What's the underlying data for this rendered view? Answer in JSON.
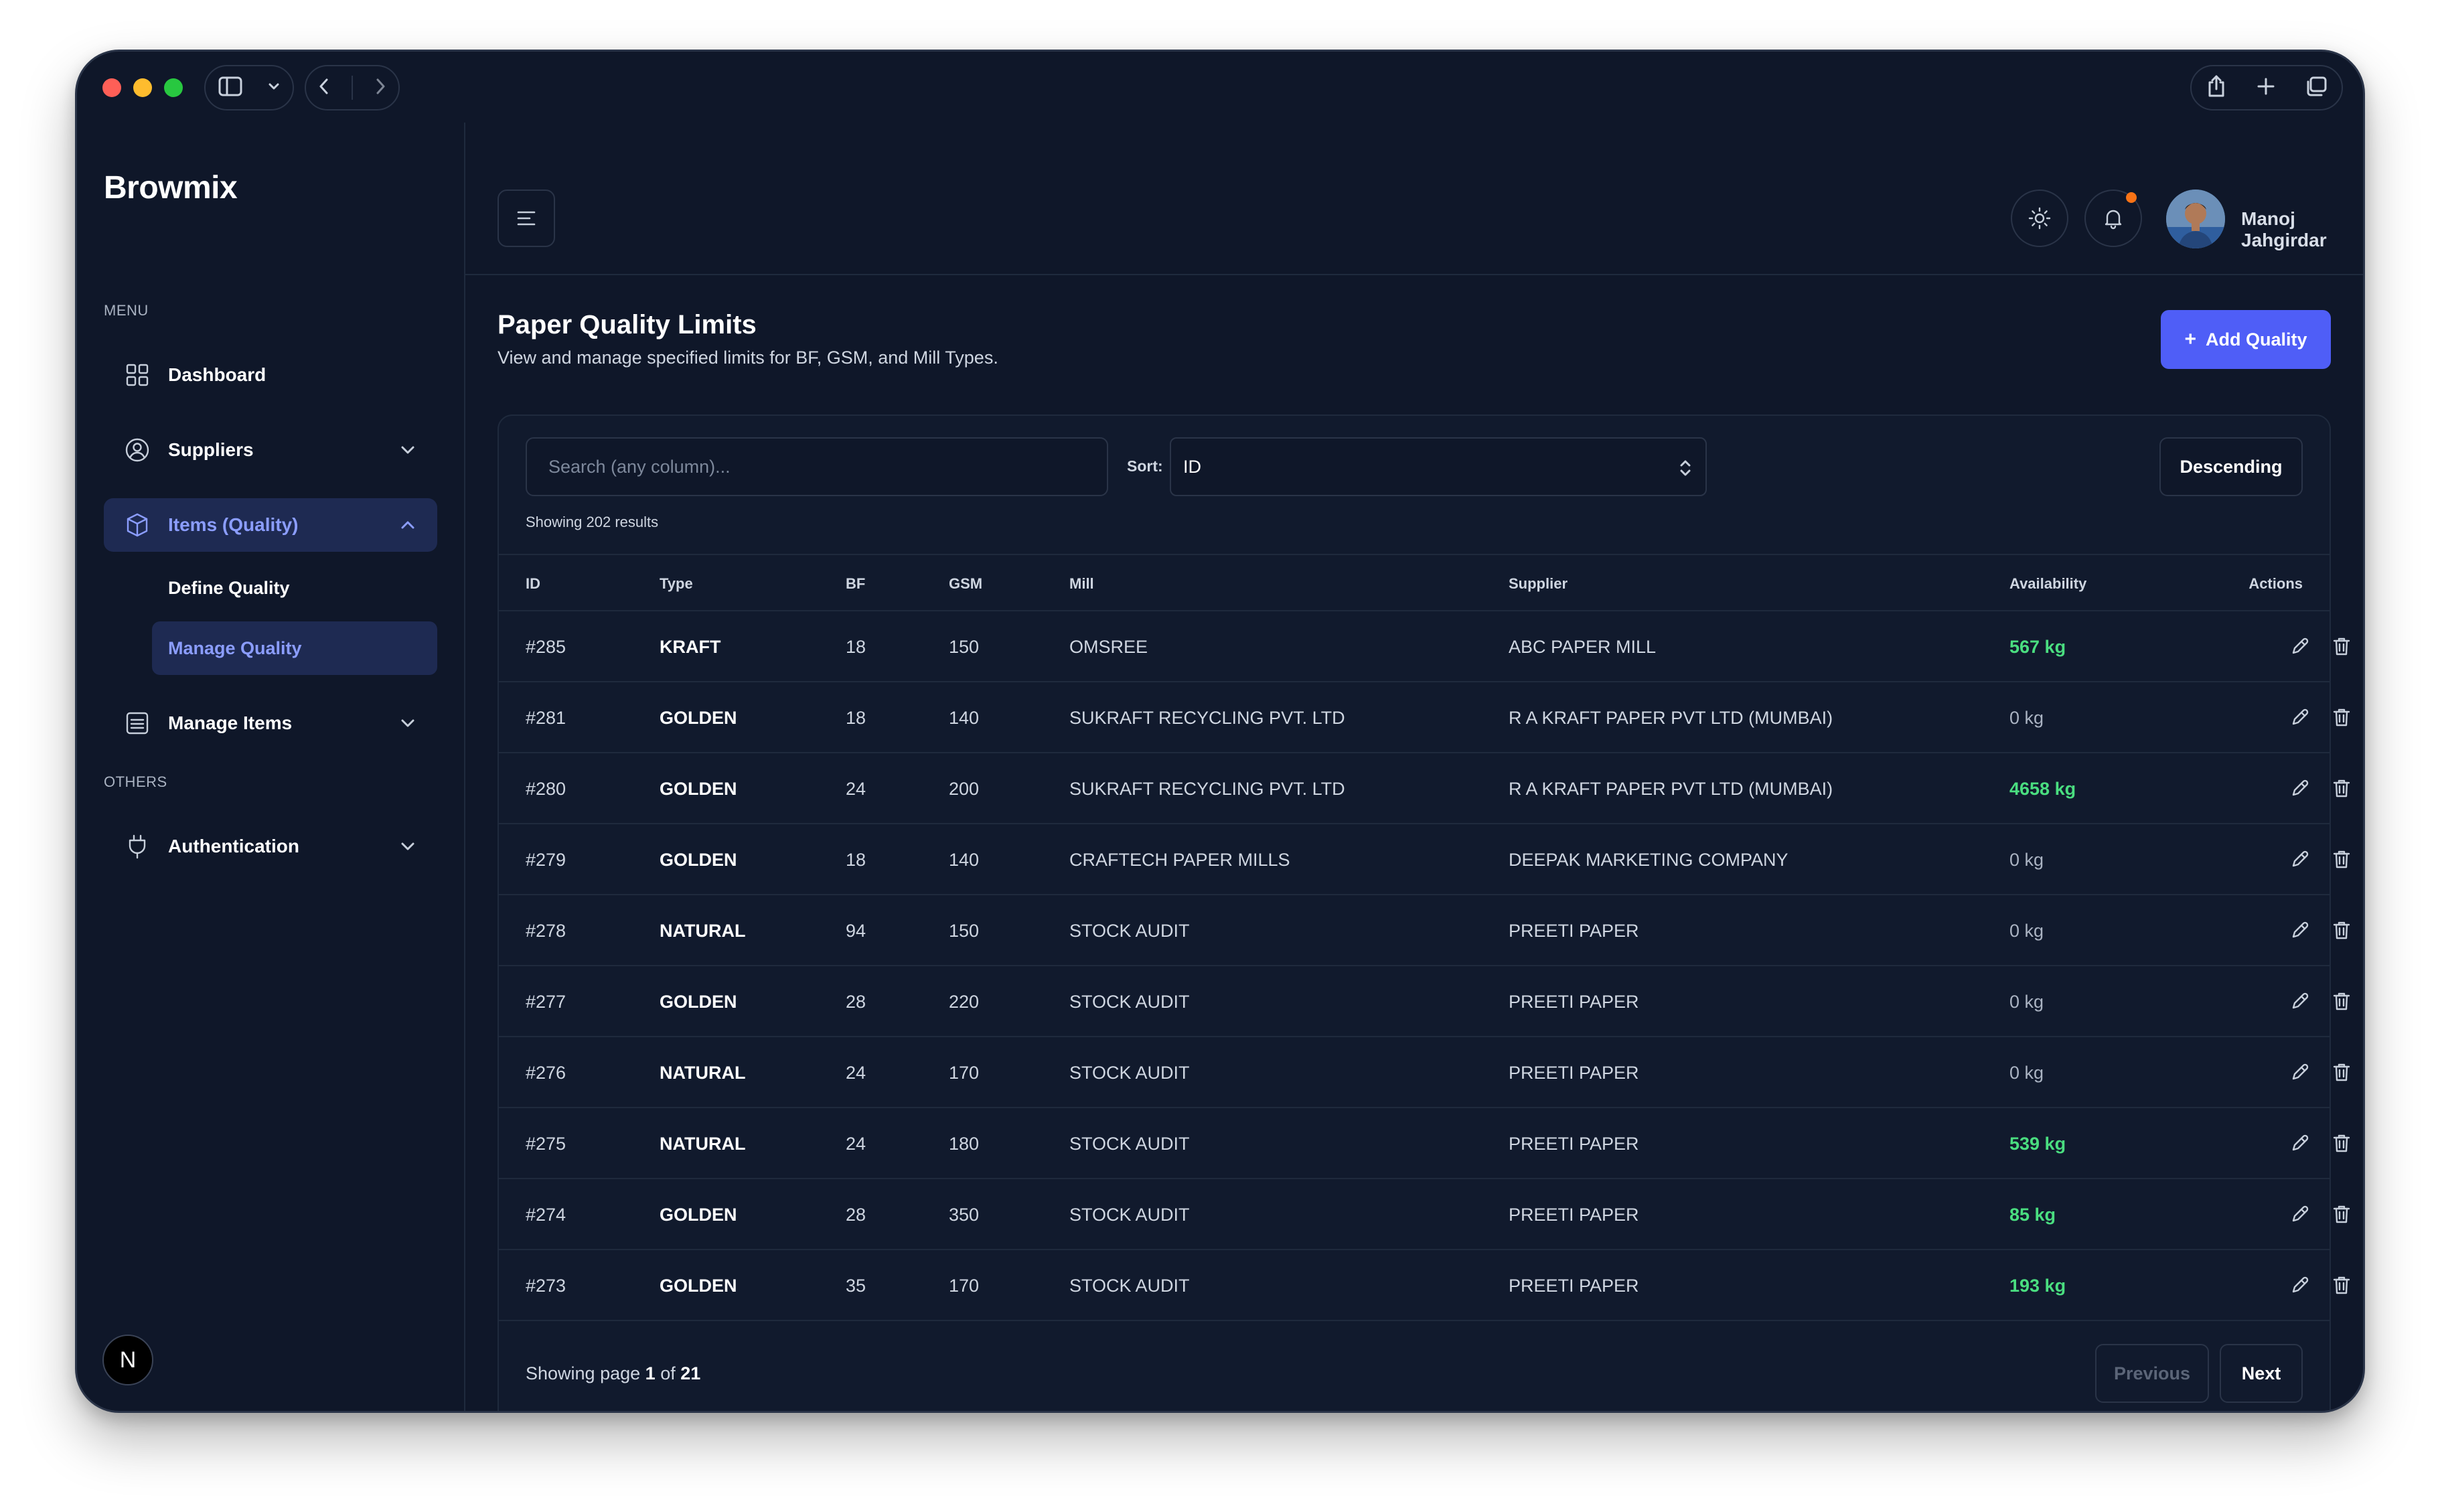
{
  "app": {
    "brand": "Browmix"
  },
  "sidebar": {
    "menu_label": "MENU",
    "others_label": "OTHERS",
    "items": [
      {
        "label": "Dashboard",
        "icon": "grid-icon"
      },
      {
        "label": "Suppliers",
        "icon": "user-circle-icon"
      },
      {
        "label": "Items (Quality)",
        "icon": "box-icon"
      },
      {
        "label": "Manage Items",
        "icon": "list-icon"
      },
      {
        "label": "Authentication",
        "icon": "plug-icon"
      }
    ],
    "sub_items": [
      {
        "label": "Define Quality"
      },
      {
        "label": "Manage Quality"
      }
    ],
    "badge": "N"
  },
  "header": {
    "user_name": "Manoj Jahgirdar"
  },
  "page": {
    "title": "Paper Quality Limits",
    "subtitle": "View and manage specified limits for BF, GSM, and Mill Types.",
    "add_button": "Add Quality",
    "add_button_icon": "+"
  },
  "toolbar": {
    "search_placeholder": "Search (any column)...",
    "sort_label": "Sort:",
    "sort_value": "ID",
    "order_button": "Descending",
    "results_text": "Showing 202 results"
  },
  "table": {
    "columns": [
      "ID",
      "Type",
      "BF",
      "GSM",
      "Mill",
      "Supplier",
      "Availability",
      "Actions"
    ],
    "rows": [
      {
        "id": "#285",
        "type": "KRAFT",
        "bf": "18",
        "gsm": "150",
        "mill": "OMSREE",
        "supplier": "ABC PAPER MILL",
        "availability": "567 kg"
      },
      {
        "id": "#281",
        "type": "GOLDEN",
        "bf": "18",
        "gsm": "140",
        "mill": "SUKRAFT RECYCLING PVT. LTD",
        "supplier": "R A KRAFT PAPER PVT LTD (MUMBAI)",
        "availability": "0 kg"
      },
      {
        "id": "#280",
        "type": "GOLDEN",
        "bf": "24",
        "gsm": "200",
        "mill": "SUKRAFT RECYCLING PVT. LTD",
        "supplier": "R A KRAFT PAPER PVT LTD (MUMBAI)",
        "availability": "4658 kg"
      },
      {
        "id": "#279",
        "type": "GOLDEN",
        "bf": "18",
        "gsm": "140",
        "mill": "CRAFTECH PAPER MILLS",
        "supplier": "DEEPAK MARKETING COMPANY",
        "availability": "0 kg"
      },
      {
        "id": "#278",
        "type": "NATURAL",
        "bf": "94",
        "gsm": "150",
        "mill": "STOCK AUDIT",
        "supplier": "PREETI PAPER",
        "availability": "0 kg"
      },
      {
        "id": "#277",
        "type": "GOLDEN",
        "bf": "28",
        "gsm": "220",
        "mill": "STOCK AUDIT",
        "supplier": "PREETI PAPER",
        "availability": "0 kg"
      },
      {
        "id": "#276",
        "type": "NATURAL",
        "bf": "24",
        "gsm": "170",
        "mill": "STOCK AUDIT",
        "supplier": "PREETI PAPER",
        "availability": "0 kg"
      },
      {
        "id": "#275",
        "type": "NATURAL",
        "bf": "24",
        "gsm": "180",
        "mill": "STOCK AUDIT",
        "supplier": "PREETI PAPER",
        "availability": "539 kg"
      },
      {
        "id": "#274",
        "type": "GOLDEN",
        "bf": "28",
        "gsm": "350",
        "mill": "STOCK AUDIT",
        "supplier": "PREETI PAPER",
        "availability": "85 kg"
      },
      {
        "id": "#273",
        "type": "GOLDEN",
        "bf": "35",
        "gsm": "170",
        "mill": "STOCK AUDIT",
        "supplier": "PREETI PAPER",
        "availability": "193 kg"
      }
    ]
  },
  "pagination": {
    "prefix": "Showing page",
    "current": "1",
    "of": "of",
    "total": "21",
    "previous": "Previous",
    "next": "Next"
  },
  "colors": {
    "background": "#0f1729",
    "accent": "#4f5ef7",
    "active_text": "#8b9dff",
    "available": "#4ade80",
    "notification": "#f97316"
  }
}
